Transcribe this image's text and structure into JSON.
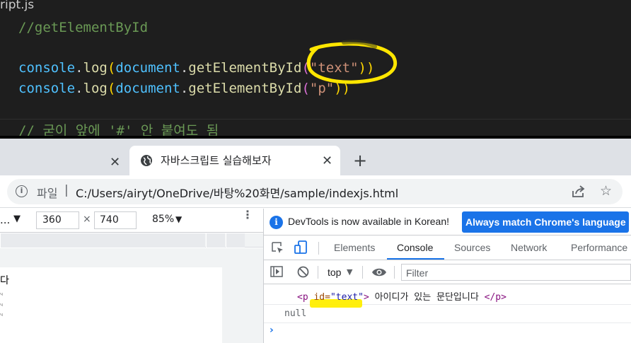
{
  "editor": {
    "file_name": "ript.js",
    "lines": {
      "comment1": "//getElementById",
      "l1_obj": "console",
      "l1_dot": ".",
      "l1_fn": "log",
      "l1_p1": "(",
      "l1_doc": "document",
      "l1_dot2": ".",
      "l1_fn2": "getElementById",
      "l1_p2": "(",
      "l1_str": "\"text\"",
      "l1_close": "))",
      "l2_obj": "console",
      "l2_dot": ".",
      "l2_fn": "log",
      "l2_p1": "(",
      "l2_doc": "document",
      "l2_dot2": ".",
      "l2_fn2": "getElementById",
      "l2_p2": "(",
      "l2_str": "\"p\"",
      "l2_close": "))",
      "comment2": "// 굳이 앞에 '#' 안 붙여도 됨"
    },
    "annotation_color": "#ffe600"
  },
  "browser": {
    "tab_title": "자바스크립트 실습해보자",
    "tab_close": "✕",
    "prev_tab_close": "✕",
    "new_tab": "+",
    "url_scheme": "파일",
    "url_sep": "|",
    "url": "C:/Users/airyt/OneDrive/바탕%20화면/sample/indexjs.html",
    "info_icon": "i",
    "star_icon": "☆"
  },
  "device_toolbar": {
    "device_label": "...",
    "device_arrow": "▼",
    "width": "360",
    "times": "×",
    "height": "740",
    "zoom": "85%",
    "zoom_arrow": "▼",
    "more": "⋮"
  },
  "page": {
    "text_fragment": "다",
    "tiny_marks": [
      "ч",
      "ч",
      "ч"
    ]
  },
  "devtools": {
    "notice_icon": "i",
    "notice_text": "DevTools is now available in Korean!",
    "notice_button": "Always match Chrome's language",
    "tabs": [
      "Elements",
      "Console",
      "Sources",
      "Network",
      "Performance"
    ],
    "active_tab": "Console",
    "context": "top",
    "context_arrow": "▼",
    "filter_placeholder": "Filter",
    "console": {
      "el_open": "<p",
      "attr_name": " id=",
      "attr_value": "\"text\"",
      "el_close_bracket": ">",
      "el_text": " 아이디가 있는 문단입니다 ",
      "el_end": "</p>",
      "null_output": "null",
      "prompt": "›"
    },
    "accent_color": "#1a73e8"
  }
}
